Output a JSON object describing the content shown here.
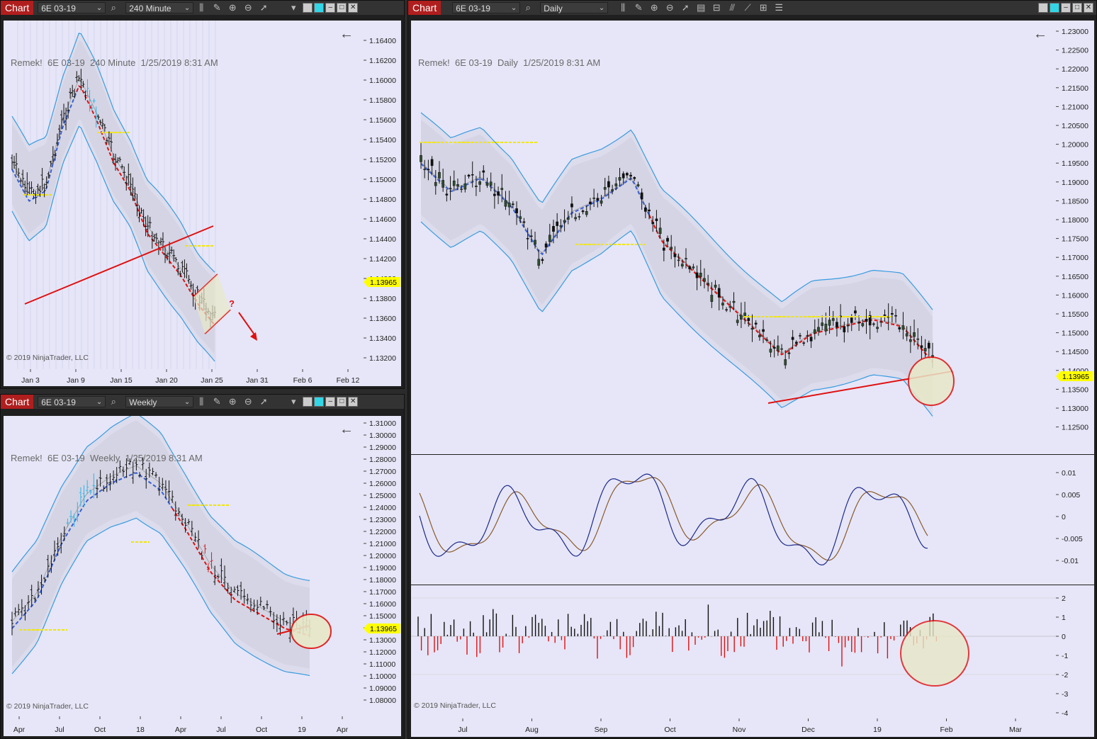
{
  "windows": [
    {
      "id": "w240",
      "app_label": "Chart",
      "instrument": "6E 03-19",
      "interval": "240 Minute",
      "title": "Remek!  6E 03-19  240 Minute  1/25/2019 8:31 AM",
      "copyright": "© 2019 NinjaTrader, LLC",
      "price_labels": [
        "1.16400",
        "1.16200",
        "1.16000",
        "1.15800",
        "1.15600",
        "1.15400",
        "1.15200",
        "1.15000",
        "1.14800",
        "1.14600",
        "1.14400",
        "1.14200",
        "1.14000",
        "1.13800",
        "1.13600",
        "1.13400",
        "1.13200"
      ],
      "last_price": "1.13965",
      "time_labels": [
        "Jan 3",
        "Jan 9",
        "Jan 15",
        "Jan 20",
        "Jan 25",
        "Jan 31",
        "Feb 6",
        "Feb 12"
      ],
      "annotation": "?"
    },
    {
      "id": "wweek",
      "app_label": "Chart",
      "instrument": "6E 03-19",
      "interval": "Weekly",
      "title": "Remek!  6E 03-19  Weekly  1/25/2019 8:31 AM",
      "copyright": "© 2019 NinjaTrader, LLC",
      "price_labels": [
        "1.31000",
        "1.30000",
        "1.29000",
        "1.28000",
        "1.27000",
        "1.26000",
        "1.25000",
        "1.24000",
        "1.23000",
        "1.22000",
        "1.21000",
        "1.20000",
        "1.19000",
        "1.18000",
        "1.17000",
        "1.16000",
        "1.15000",
        "1.14000",
        "1.13000",
        "1.12000",
        "1.11000",
        "1.10000",
        "1.09000",
        "1.08000"
      ],
      "last_price": "1.13965",
      "time_labels": [
        "Apr",
        "Jul",
        "Oct",
        "18",
        "Apr",
        "Jul",
        "Oct",
        "19",
        "Apr"
      ]
    },
    {
      "id": "wdaily",
      "app_label": "Chart",
      "instrument": "6E 03-19",
      "interval": "Daily",
      "title": "Remek!  6E 03-19  Daily  1/25/2019 8:31 AM",
      "copyright": "© 2019 NinjaTrader, LLC",
      "price_labels": [
        "1.23000",
        "1.22500",
        "1.22000",
        "1.21500",
        "1.21000",
        "1.20500",
        "1.20000",
        "1.19500",
        "1.19000",
        "1.18500",
        "1.18000",
        "1.17500",
        "1.17000",
        "1.16500",
        "1.16000",
        "1.15500",
        "1.15000",
        "1.14500",
        "1.14000",
        "1.13500",
        "1.13000",
        "1.12500"
      ],
      "last_price": "1.13965",
      "osc_labels": [
        "0.01",
        "0.005",
        "0",
        "-0.005",
        "-0.01"
      ],
      "hist_labels": [
        "2",
        "1",
        "0",
        "-1",
        "-2",
        "-3",
        "-4"
      ],
      "time_labels": [
        "Jul",
        "Aug",
        "Sep",
        "Oct",
        "Nov",
        "Dec",
        "19",
        "Feb",
        "Mar"
      ]
    }
  ],
  "colors": {
    "bg": "#e6e6f8",
    "band": "#d4d4e4",
    "upper_band": "#3a9be0",
    "red_line": "#e01010",
    "blue_dash": "#3a5fd0",
    "yellow": "#f2e600",
    "last_price_bg": "#ffff00"
  },
  "icons": [
    "search-icon",
    "bars-icon",
    "pencil-icon",
    "zoom-in-icon",
    "zoom-out-icon",
    "pointer-icon",
    "dropdown-icon",
    "back-arrow-icon"
  ]
}
